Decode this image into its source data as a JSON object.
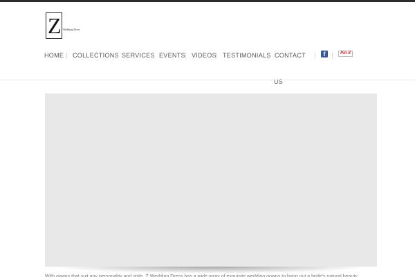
{
  "brand": {
    "logo_letter": "Z",
    "logo_small_text": "Wedding Dress"
  },
  "nav": {
    "items": [
      {
        "label": "Home"
      },
      {
        "label": "Collections"
      },
      {
        "label": "Services"
      },
      {
        "label": "Events"
      },
      {
        "label": "Videos"
      },
      {
        "label": "Testimonials"
      },
      {
        "label": "Contact"
      }
    ],
    "contact_wrap": "Us"
  },
  "social": {
    "facebook_icon": "facebook-icon",
    "pinterest_label": "Pin it"
  },
  "hero": {
    "image_placeholder": "hero-image"
  },
  "caption": {
    "text": "With gowns that suit any personality and style, Z Wedding Dress has a wide array of exquisite wedding gowns to bring out a bride's natural beauty."
  },
  "colors": {
    "topbar": "#2b2b2b",
    "nav_text": "#555555",
    "hero_bg": "#e8e8e8",
    "facebook": "#3b5998",
    "pinterest": "#cb2027"
  }
}
